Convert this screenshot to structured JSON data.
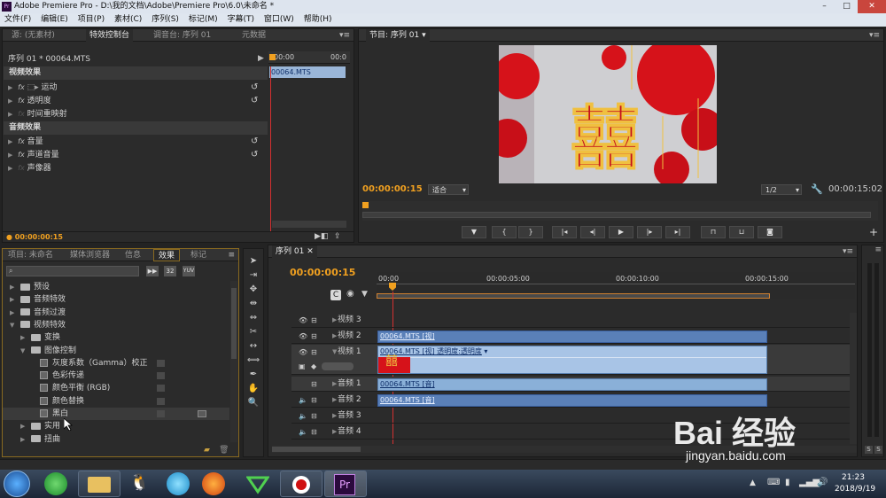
{
  "window": {
    "title": "Adobe Premiere Pro - D:\\我的文档\\Adobe\\Premiere Pro\\6.0\\未命名 *",
    "app_icon": "Pr",
    "minimize": "–",
    "maximize": "□",
    "close": "✕"
  },
  "menu": [
    "文件(F)",
    "编辑(E)",
    "项目(P)",
    "素材(C)",
    "序列(S)",
    "标记(M)",
    "字幕(T)",
    "窗口(W)",
    "帮助(H)"
  ],
  "source_panel": {
    "tabs": [
      "源: (无素材)",
      "特效控制台",
      "调音台: 序列 01",
      "元数据"
    ],
    "active_tab": 1,
    "clip_name": "序列 01 * 00064.MTS",
    "ruler_start": "00:00",
    "ruler_end": "00:0",
    "clip_bar": "00064.MTS",
    "video_header": "视频效果",
    "video_items": [
      "运动",
      "透明度",
      "时间重映射"
    ],
    "audio_header": "音频效果",
    "audio_items": [
      "音量",
      "声道音量",
      "声像器"
    ],
    "timecode": "00:00:00:15"
  },
  "program_panel": {
    "tab": "节目: 序列 01",
    "timecode_left": "00:00:00:15",
    "fit": "适合",
    "resolution": "1/2",
    "timecode_right": "00:00:15:02",
    "image_colors": {
      "lantern": "#d6121a",
      "bg": "#cfcfd2",
      "character": "#c4101c",
      "gold": "#f0c040"
    }
  },
  "project_panel": {
    "tabs": [
      "项目: 未命名",
      "媒体浏览器",
      "信息",
      "效果",
      "标记"
    ],
    "active_tab": 3,
    "icon_labels": [
      "32",
      "YUV"
    ],
    "tree": [
      {
        "label": "预设",
        "level": 0,
        "type": "folder"
      },
      {
        "label": "音频特效",
        "level": 0,
        "type": "folder"
      },
      {
        "label": "音频过渡",
        "level": 0,
        "type": "folder"
      },
      {
        "label": "视频特效",
        "level": 0,
        "type": "folder",
        "open": true
      },
      {
        "label": "变换",
        "level": 1,
        "type": "folder"
      },
      {
        "label": "图像控制",
        "level": 1,
        "type": "folder",
        "open": true
      },
      {
        "label": "灰度系数（Gamma）校正",
        "level": 2,
        "type": "preset"
      },
      {
        "label": "色彩传递",
        "level": 2,
        "type": "preset"
      },
      {
        "label": "颜色平衡 (RGB)",
        "level": 2,
        "type": "preset"
      },
      {
        "label": "颜色替换",
        "level": 2,
        "type": "preset"
      },
      {
        "label": "黑白",
        "level": 2,
        "type": "preset",
        "selected": true
      },
      {
        "label": "实用",
        "level": 1,
        "type": "folder"
      },
      {
        "label": "扭曲",
        "level": 1,
        "type": "folder"
      }
    ]
  },
  "timeline_panel": {
    "tab": "序列 01",
    "timecode": "00:00:00:15",
    "ruler": [
      "00:00",
      "00:00:05:00",
      "00:00:10:00",
      "00:00:15:00"
    ],
    "tracks": [
      {
        "name": "视频 3",
        "clip": ""
      },
      {
        "name": "视频 2",
        "clip": "00064.MTS [视]"
      },
      {
        "name": "视频 1",
        "clip": "00064.MTS [视] 透明度:透明度"
      },
      {
        "name": "音频 1",
        "clip": "00064.MTS [音]"
      },
      {
        "name": "音频 2",
        "clip": "00064.MTS [音]"
      },
      {
        "name": "音频 3",
        "clip": ""
      },
      {
        "name": "音频 4",
        "clip": ""
      }
    ]
  },
  "right_meters": {
    "s1": "S",
    "s2": "S"
  },
  "watermark": {
    "brand": "Bai 经验",
    "url": "jingyan.baidu.com"
  },
  "taskbar": {
    "time": "21:23",
    "date": "2018/9/19"
  }
}
